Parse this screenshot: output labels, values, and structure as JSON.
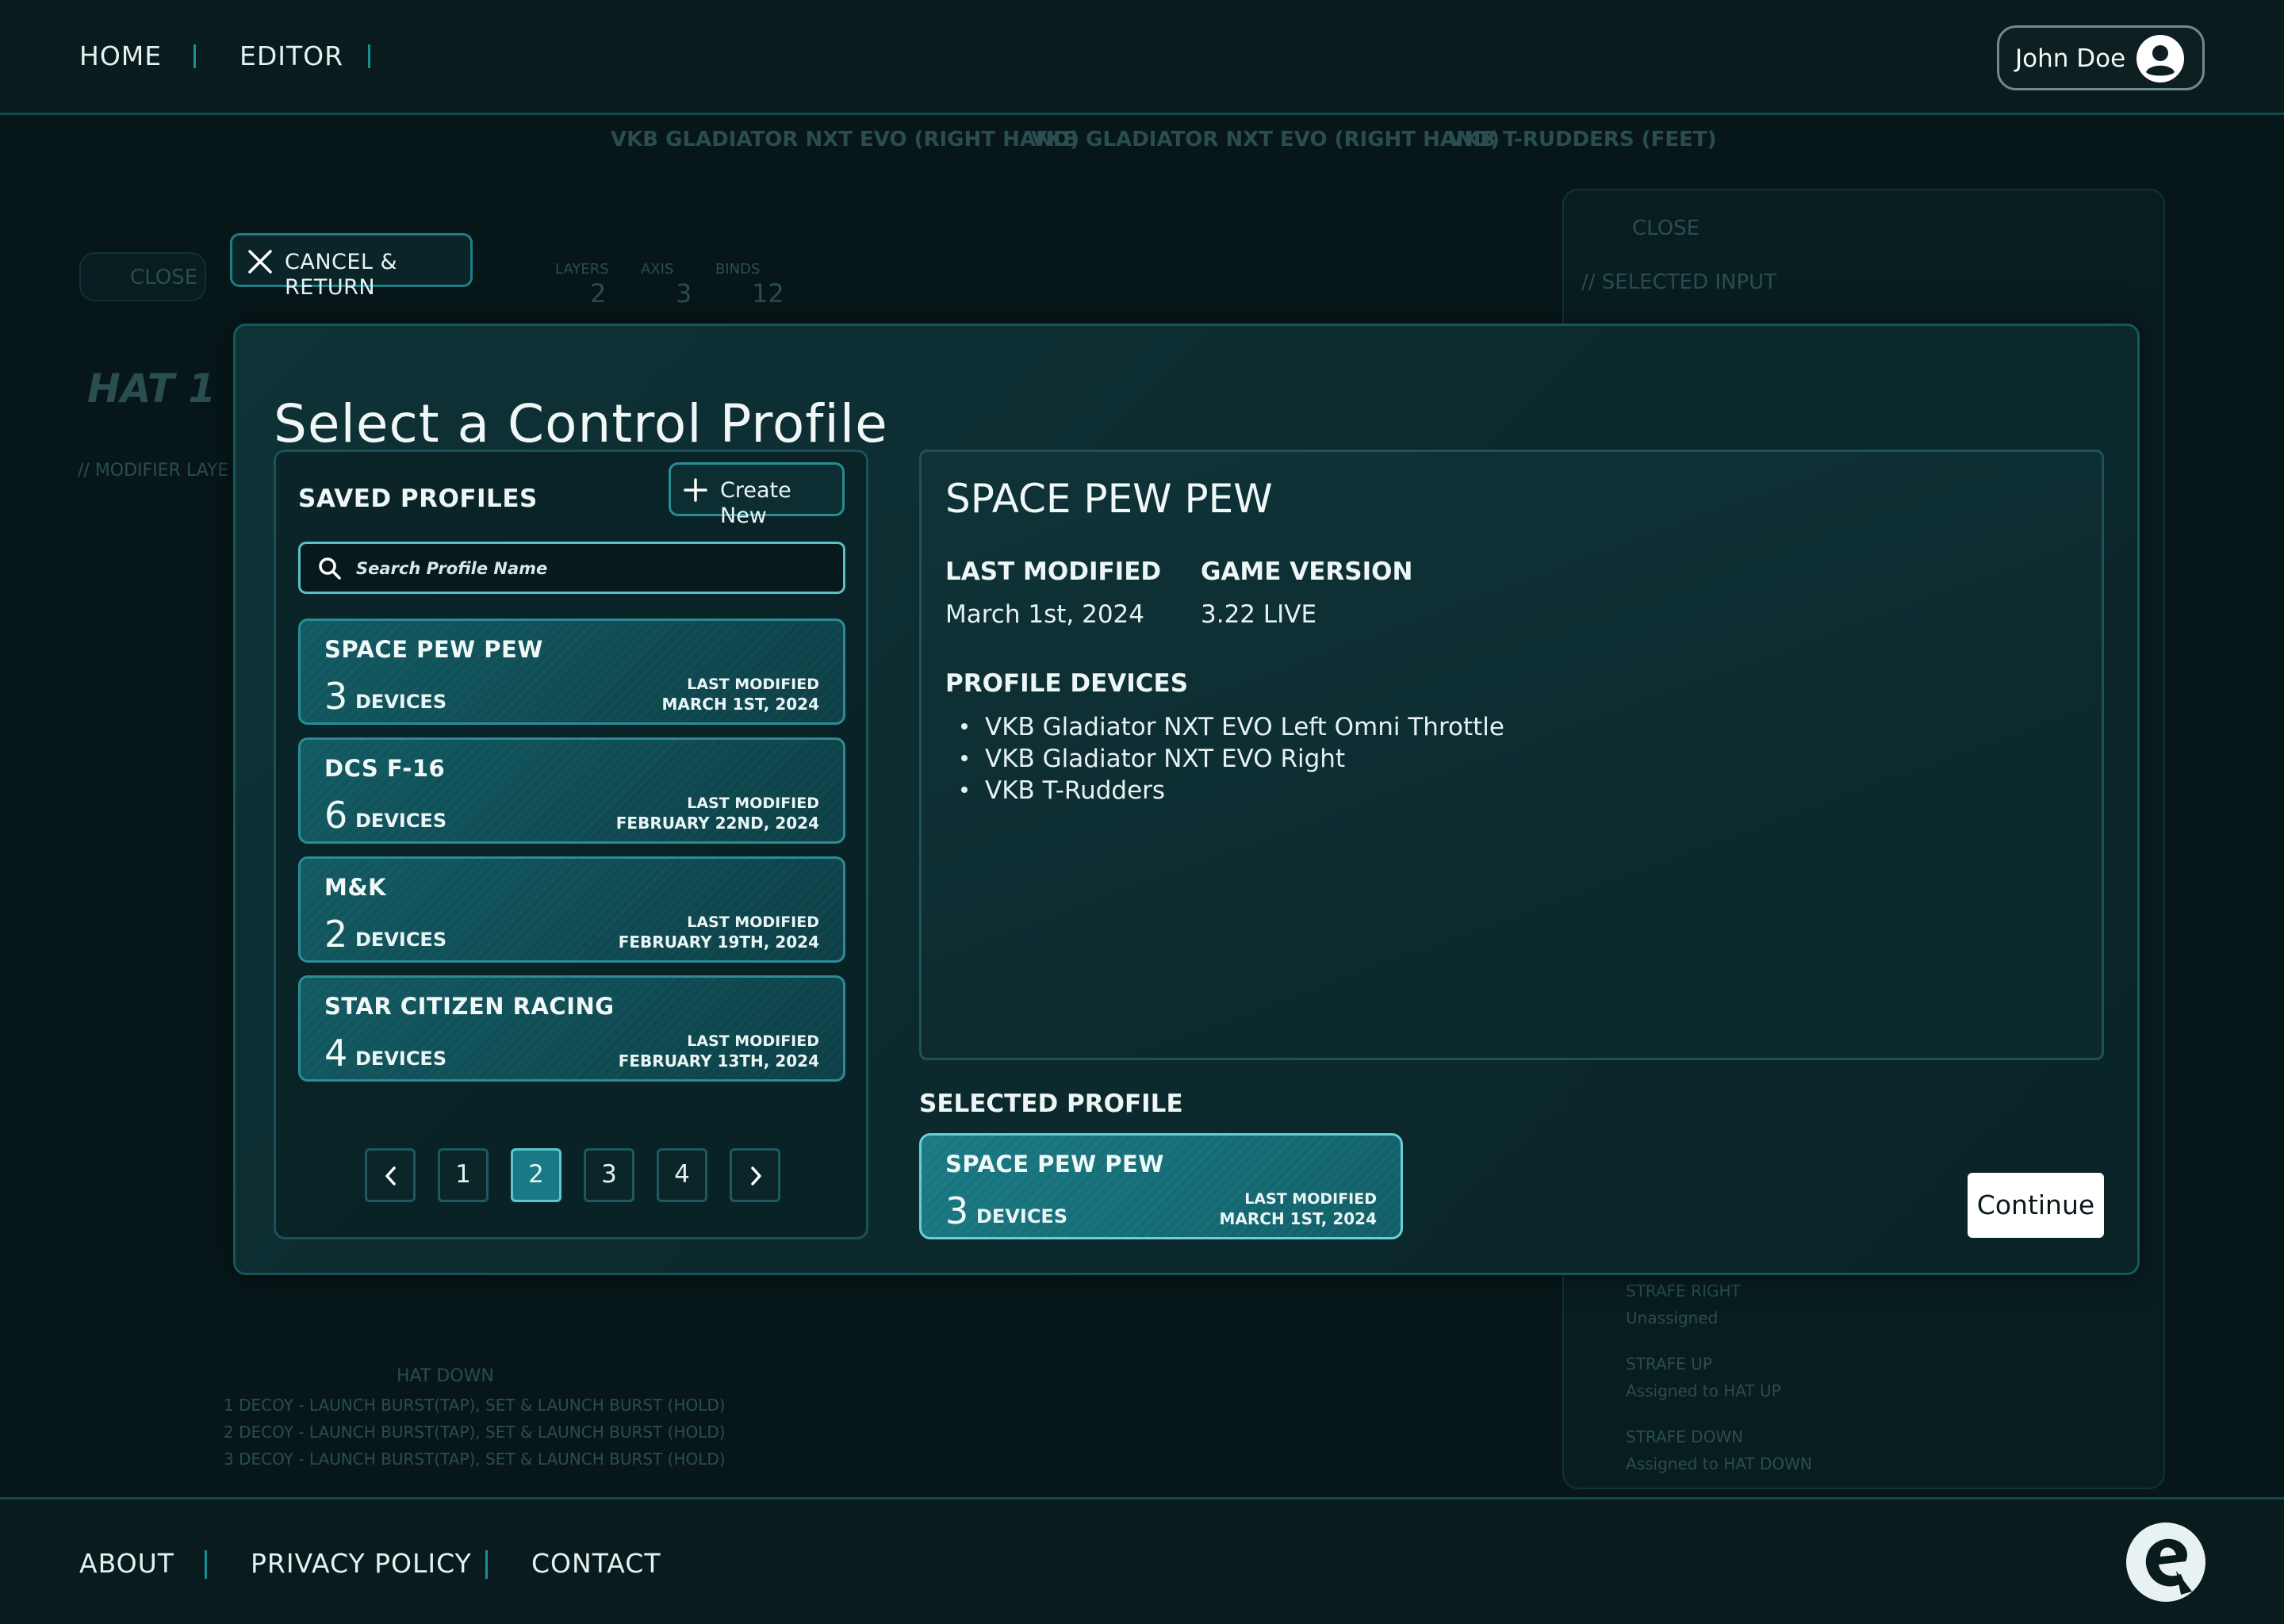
{
  "nav": {
    "links": [
      "HOME",
      "EDITOR"
    ],
    "user_name": "John Doe"
  },
  "cancel": {
    "label": "CANCEL & RETURN"
  },
  "modal": {
    "title": "Select a Control Profile",
    "saved_profiles_title": "SAVED PROFILES",
    "create_new_label": "Create New",
    "search_placeholder": "Search Profile Name",
    "profiles": [
      {
        "name": "SPACE PEW PEW",
        "count": "3",
        "devices_label": "DEVICES",
        "modified_label": "LAST MODIFIED",
        "modified_date": "MARCH 1ST, 2024"
      },
      {
        "name": "DCS F-16",
        "count": "6",
        "devices_label": "DEVICES",
        "modified_label": "LAST MODIFIED",
        "modified_date": "FEBRUARY 22ND, 2024"
      },
      {
        "name": "M&K",
        "count": "2",
        "devices_label": "DEVICES",
        "modified_label": "LAST MODIFIED",
        "modified_date": "FEBRUARY 19TH, 2024"
      },
      {
        "name": "STAR CITIZEN RACING",
        "count": "4",
        "devices_label": "DEVICES",
        "modified_label": "LAST MODIFIED",
        "modified_date": "FEBRUARY 13TH, 2024"
      }
    ],
    "pagination": {
      "pages": [
        "1",
        "2",
        "3",
        "4"
      ],
      "current": "2"
    },
    "detail": {
      "name": "SPACE PEW PEW",
      "last_modified_label": "LAST MODIFIED",
      "last_modified_value": "March 1st, 2024",
      "game_version_label": "GAME VERSION",
      "game_version_value": "3.22 LIVE",
      "devices_label": "PROFILE DEVICES",
      "devices": [
        "VKB Gladiator NXT EVO Left Omni Throttle",
        "VKB Gladiator NXT EVO Right",
        "VKB T-Rudders"
      ]
    },
    "selected_label": "SELECTED PROFILE",
    "selected": {
      "name": "SPACE PEW PEW",
      "count": "3",
      "devices_label": "DEVICES",
      "modified_label": "LAST MODIFIED",
      "modified_date": "MARCH 1ST, 2024"
    },
    "continue_label": "Continue"
  },
  "footer": {
    "links": [
      "ABOUT",
      "PRIVACY POLICY",
      "CONTACT"
    ]
  },
  "background": {
    "tabs": [
      "VKB GLADIATOR NXT EVO (RIGHT HAND)",
      "VKB GLADIATOR NXT EVO (RIGHT HAND)",
      "VKB T-RUDDERS (FEET)"
    ],
    "close_left": "CLOSE",
    "hat_title": "HAT 1",
    "modifier_label": "// MODIFIER LAYE",
    "stats": [
      "LAYERS",
      "AXIS",
      "BINDS"
    ],
    "stat_values": [
      "2",
      "3",
      "12"
    ],
    "close_right": "CLOSE",
    "selected_input": "// SELECTED INPUT",
    "hat_down": "HAT DOWN",
    "binds": [
      "1  DECOY - LAUNCH BURST(TAP), SET & LAUNCH BURST (HOLD)",
      "2  DECOY - LAUNCH BURST(TAP), SET & LAUNCH BURST (HOLD)",
      "3  DECOY - LAUNCH BURST(TAP), SET & LAUNCH BURST (HOLD)"
    ],
    "right_binds": [
      "STRAFE RIGHT",
      "Unassigned",
      "STRAFE UP",
      "Assigned to HAT UP",
      "STRAFE DOWN",
      "Assigned to HAT DOWN"
    ]
  },
  "colors": {
    "accent": "#2b8c95",
    "highlight": "#68cfd7",
    "background": "#071719"
  }
}
